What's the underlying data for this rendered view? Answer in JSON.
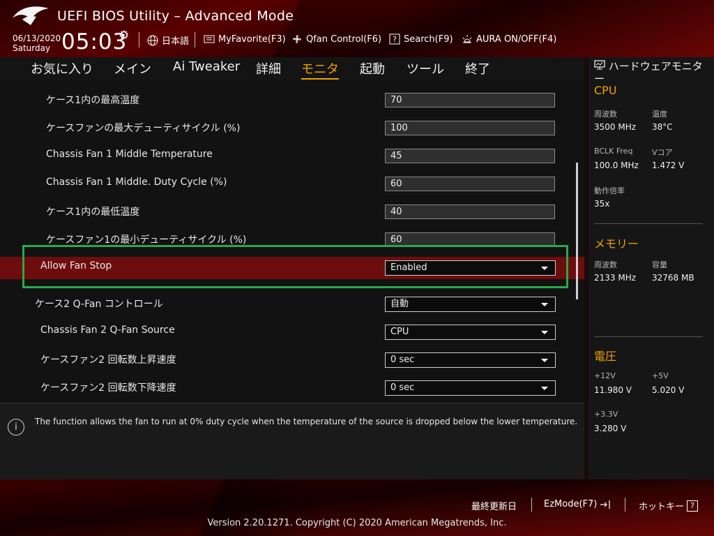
{
  "header": {
    "title": "UEFI BIOS Utility – Advanced Mode",
    "date": "06/13/2020",
    "day": "Saturday",
    "time": "05:03",
    "items": {
      "language": "日本語",
      "myfavorite": "MyFavorite(F3)",
      "qfan": "Qfan Control(F6)",
      "search": "Search(F9)",
      "aura": "AURA ON/OFF(F4)"
    }
  },
  "tabs": [
    "お気に入り",
    "メイン",
    "Ai Tweaker",
    "詳細",
    "モニタ",
    "起動",
    "ツール",
    "終了"
  ],
  "active_tab": "モニタ",
  "settings": [
    {
      "label": "ケース1内の最高温度",
      "value": "70"
    },
    {
      "label": "ケースファンの最大デューティサイクル (%)",
      "value": "100"
    },
    {
      "label": "Chassis Fan 1 Middle Temperature",
      "value": "45"
    },
    {
      "label": "Chassis Fan 1 Middle. Duty Cycle (%)",
      "value": "60"
    },
    {
      "label": "ケース1内の最低温度",
      "value": "40"
    },
    {
      "label": "ケースファン1の最小デューティサイクル (%)",
      "value": "60"
    },
    {
      "label": "Allow Fan Stop",
      "value": "Enabled"
    },
    {
      "label": "ケース2 Q-Fan コントロール",
      "value": "自動"
    },
    {
      "label": "Chassis Fan 2 Q-Fan Source",
      "value": "CPU"
    },
    {
      "label": "ケースファン2 回転数上昇速度",
      "value": "0 sec"
    },
    {
      "label": "ケースファン2 回転数下降速度",
      "value": "0 sec"
    }
  ],
  "help": "The function allows the fan to run at 0% duty cycle when the temperature of the source is dropped below the lower temperature.",
  "hwmon": {
    "title": "ハードウェアモニター",
    "cpu": {
      "heading": "CPU",
      "freq_label": "周波数",
      "freq": "3500 MHz",
      "temp_label": "温度",
      "temp": "38°C",
      "bclk_label": "BCLK Freq",
      "bclk": "100.0 MHz",
      "vcore_label": "Vコア",
      "vcore": "1.472 V",
      "ratio_label": "動作倍率",
      "ratio": "35x"
    },
    "memory": {
      "heading": "メモリー",
      "freq_label": "周波数",
      "freq": "2133 MHz",
      "cap_label": "容量",
      "cap": "32768 MB"
    },
    "voltage": {
      "heading": "電圧",
      "v12_label": "+12V",
      "v12": "11.980 V",
      "v5_label": "+5V",
      "v5": "5.020 V",
      "v33_label": "+3.3V",
      "v33": "3.280 V"
    }
  },
  "footer": {
    "last_modified": "最終更新日",
    "ezmode": "EzMode(F7)",
    "hotkeys": "ホットキー",
    "hotkeys_key": "?",
    "copyright": "Version 2.20.1271. Copyright (C) 2020 American Megatrends, Inc."
  },
  "colors": {
    "accent": "#f0a000",
    "highlight": "#6e0d0d",
    "focus": "#2aa84a"
  }
}
